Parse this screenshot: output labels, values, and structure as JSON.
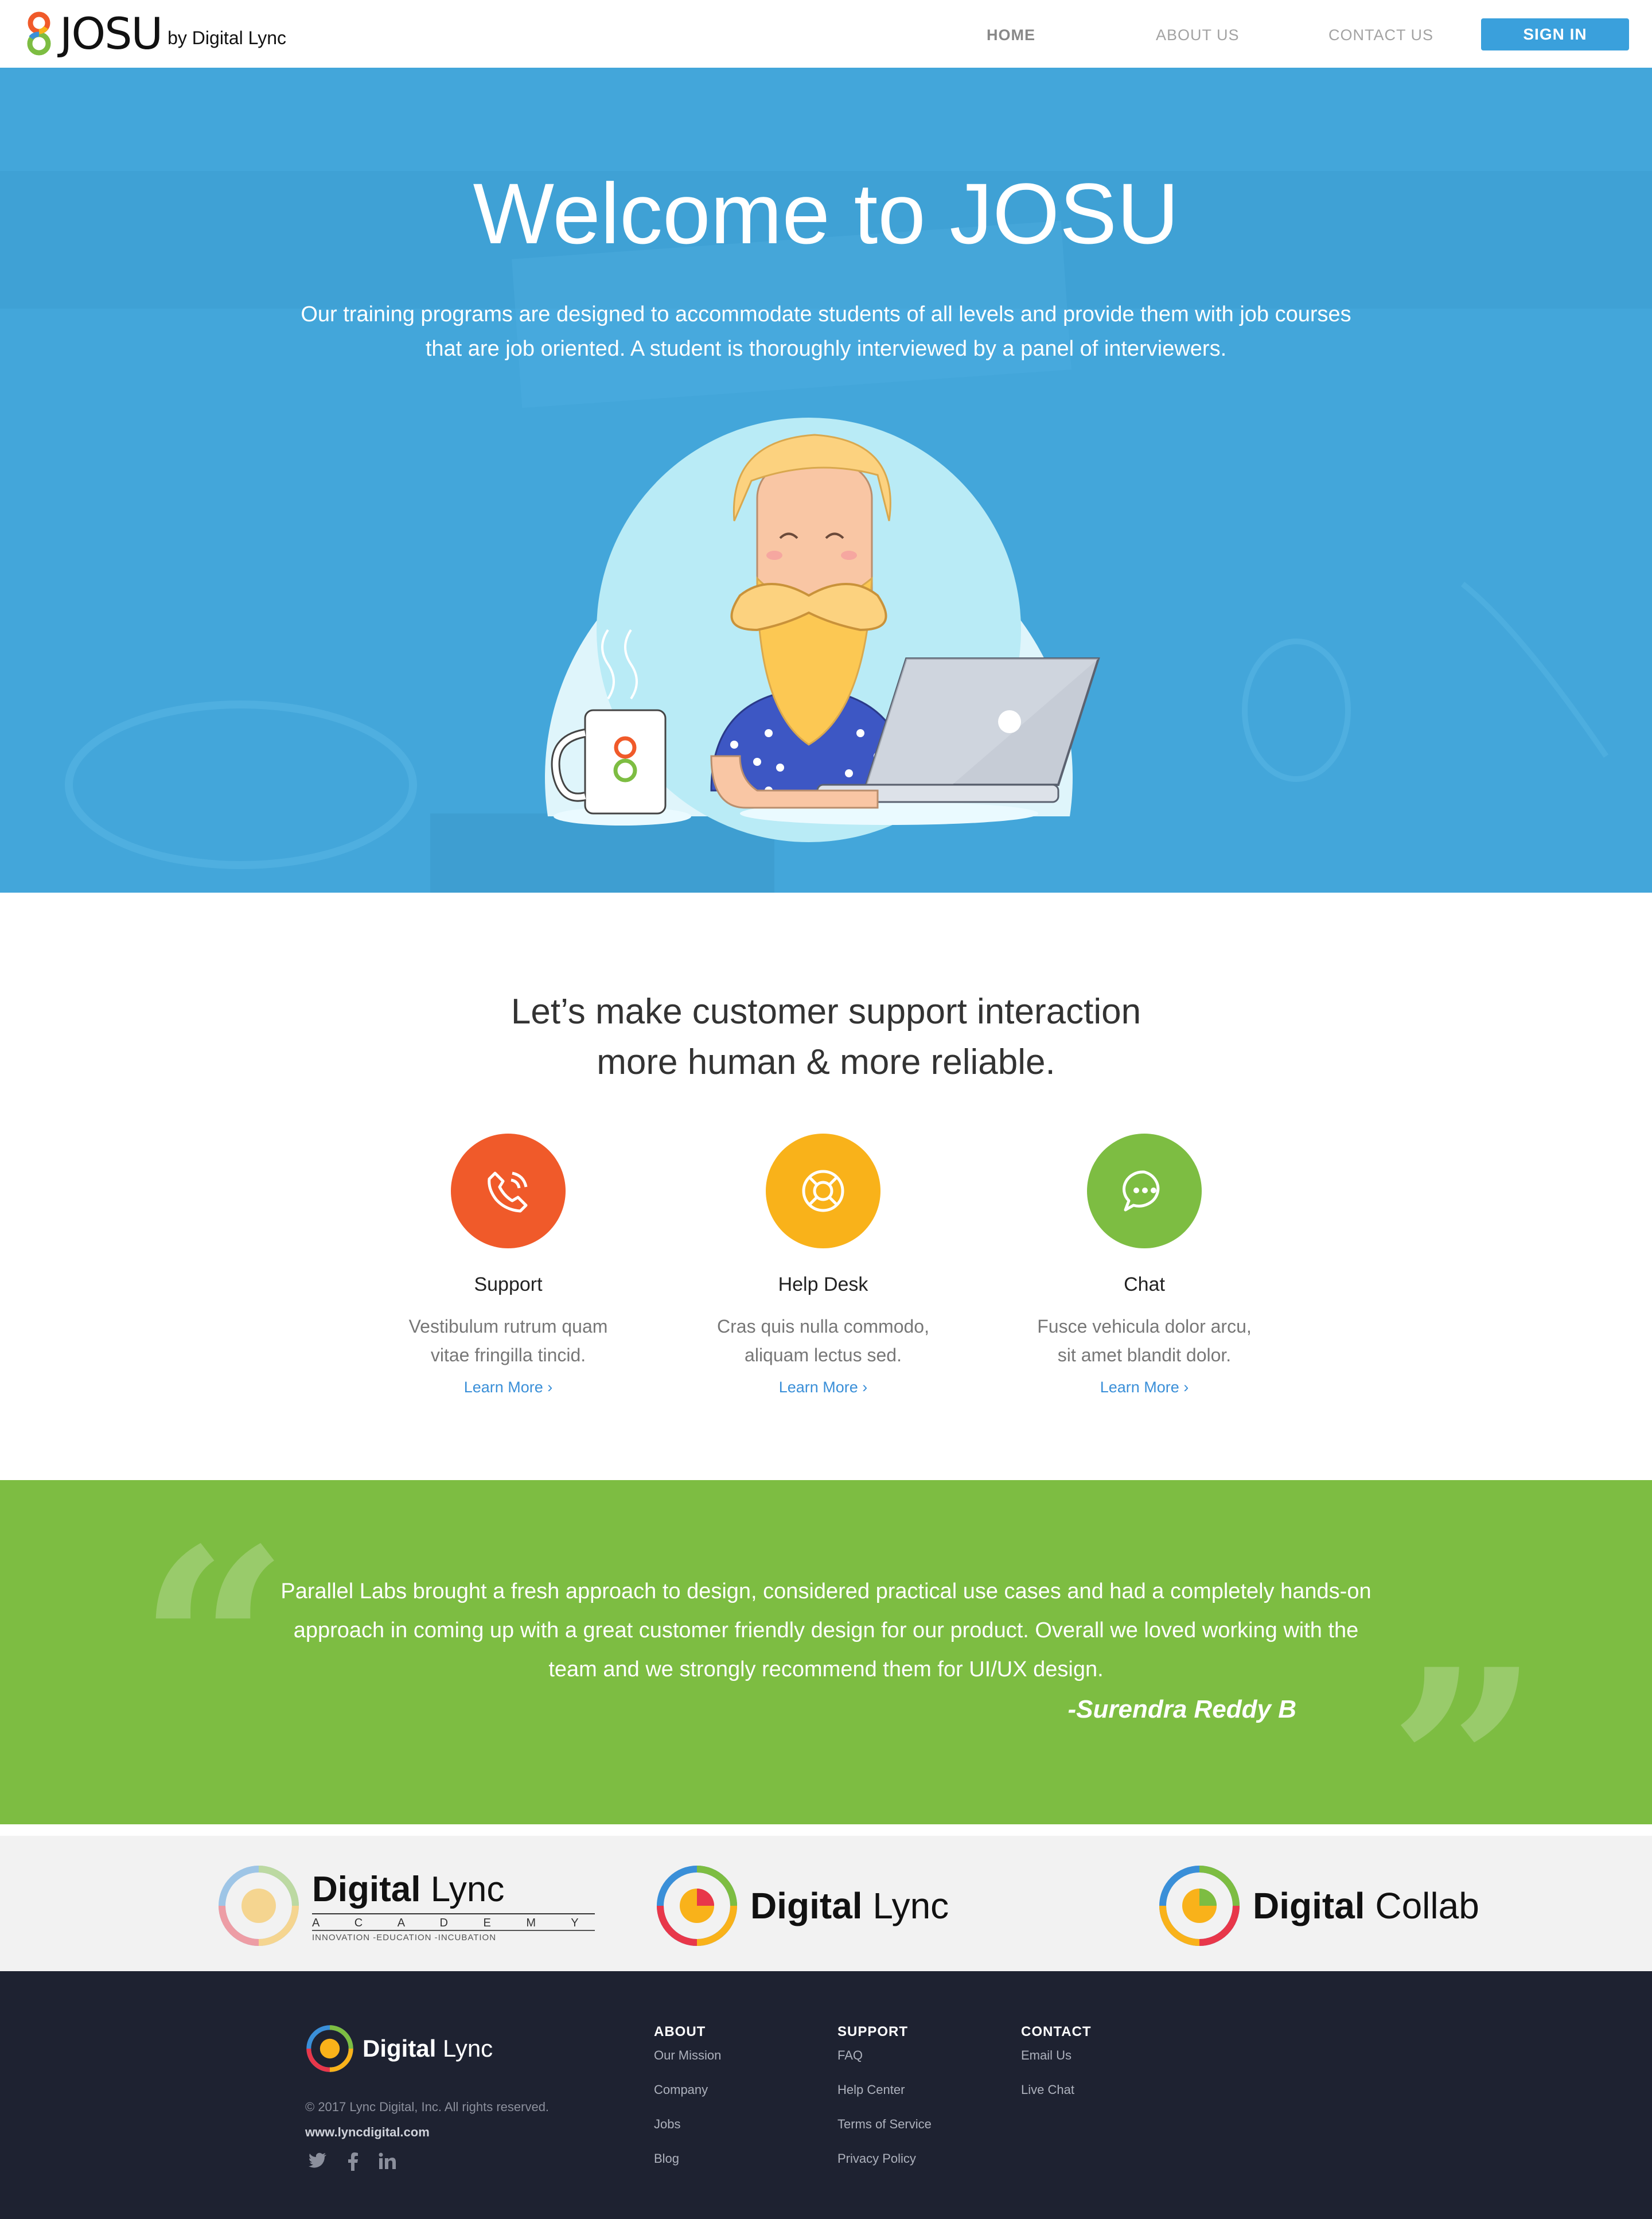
{
  "header": {
    "logo_text": "JOSU",
    "logo_by": "by Digital Lync",
    "nav": [
      {
        "label": "HOME"
      },
      {
        "label": "ABOUT US"
      },
      {
        "label": "CONTACT US"
      }
    ],
    "signin_label": "SIGN IN"
  },
  "hero": {
    "title": "Welcome to JOSU",
    "subtitle_line1": "Our training programs are designed to accommodate students of all levels and provide them with job courses",
    "subtitle_line2": "that are job oriented. A student is thoroughly interviewed by a panel of interviewers."
  },
  "features": {
    "heading_line1": "Let’s make customer support interaction",
    "heading_line2": "more human & more reliable.",
    "items": [
      {
        "title": "Support",
        "desc_line1": "Vestibulum rutrum quam",
        "desc_line2": "vitae fringilla tincid.",
        "link": "Learn More ›",
        "color": "#f05a2a",
        "icon": "phone-icon"
      },
      {
        "title": "Help Desk",
        "desc_line1": "Cras quis nulla commodo,",
        "desc_line2": "aliquam lectus sed.",
        "link": "Learn More ›",
        "color": "#f9b21a",
        "icon": "lifebuoy-icon"
      },
      {
        "title": "Chat",
        "desc_line1": "Fusce vehicula dolor arcu,",
        "desc_line2": "sit amet blandit dolor.",
        "link": "Learn More ›",
        "color": "#7dbd42",
        "icon": "chat-icon"
      }
    ]
  },
  "testimonial": {
    "line1": "Parallel Labs brought a fresh approach to design, considered practical use cases and had a completely hands-on",
    "line2": "approach in coming up with a great customer friendly design for our product. Overall we loved working with the",
    "line3": "team and we strongly recommend them for UI/UX design.",
    "author": "-Surendra Reddy B",
    "color": "#7dbd42"
  },
  "partners": [
    {
      "bold": "Digital",
      "light": "Lync",
      "sub": "A C A D E M Y",
      "tag": "INNOVATION -EDUCATION -INCUBATION"
    },
    {
      "bold": "Digital",
      "light": "Lync"
    },
    {
      "bold": "Digital",
      "light": "Collab"
    }
  ],
  "footer": {
    "brand_bold": "Digital",
    "brand_light": "Lync",
    "copyright": "© 2017 Lync Digital, Inc. All rights reserved.",
    "website": "www.lyncdigital.com",
    "social": [
      "twitter-icon",
      "facebook-icon",
      "linkedin-icon"
    ],
    "columns": [
      {
        "title": "ABOUT",
        "items": [
          "Our Mission",
          "Company",
          "Jobs",
          "Blog"
        ]
      },
      {
        "title": "SUPPORT",
        "items": [
          "FAQ",
          "Help Center",
          "Terms of Service",
          "Privacy Policy"
        ]
      },
      {
        "title": "CONTACT",
        "items": [
          "Email Us",
          "Live Chat"
        ]
      }
    ]
  },
  "colors": {
    "hero_blue": "#43a6da",
    "accent_blue": "#3aa0dc",
    "footer_bg": "#1e2231"
  }
}
